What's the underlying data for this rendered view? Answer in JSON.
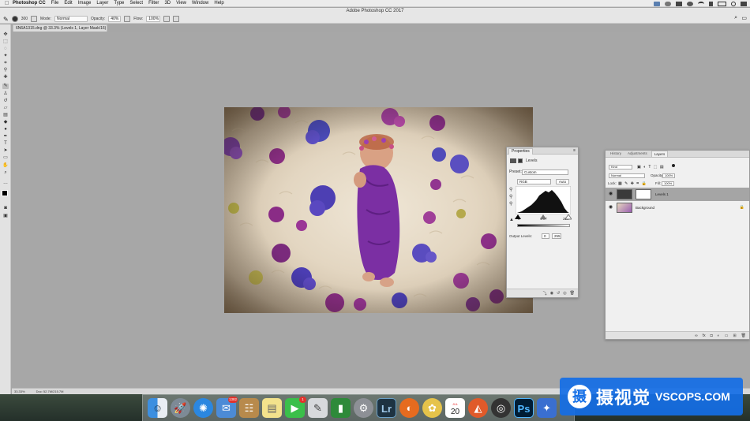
{
  "menubar": {
    "items": [
      "Photoshop CC",
      "File",
      "Edit",
      "Image",
      "Layer",
      "Type",
      "Select",
      "Filter",
      "3D",
      "View",
      "Window",
      "Help"
    ]
  },
  "window": {
    "title": "Adobe Photoshop CC 2017"
  },
  "options": {
    "mode_label": "Mode:",
    "mode_value": "Normal",
    "opacity_label": "Opacity:",
    "opacity_value": "40%",
    "flow_label": "Flow:",
    "flow_value": "100%",
    "brush_size": "300"
  },
  "document": {
    "tab": "6N6A1315.dng @ 33.3% (Levels 1, Layer Mask/16) *"
  },
  "status": {
    "zoom": "33.33%",
    "doc": "Doc: 52.7M/215.7M"
  },
  "properties": {
    "tab": "Properties",
    "adjustment": "Levels",
    "preset_label": "Preset:",
    "preset_value": "Custom",
    "channel_value": "RGB",
    "auto_label": "Auto",
    "input_low": "0",
    "input_mid": "1.07",
    "input_high": "255",
    "output_label": "Output Levels:",
    "output_low": "0",
    "output_high": "255"
  },
  "layers_panel": {
    "tabs": [
      "History",
      "Adjustments",
      "Layers"
    ],
    "kind_value": "Kind",
    "blend_value": "Normal",
    "opacity_label": "Opacity:",
    "opacity_value": "100%",
    "lock_label": "Lock:",
    "fill_label": "Fill:",
    "fill_value": "100%",
    "layers": [
      {
        "name": "Levels 1",
        "selected": true
      },
      {
        "name": "Background",
        "selected": false
      }
    ]
  },
  "dock": {
    "mail_badge": "1382",
    "facetime_badge": "1",
    "calendar_day": "20",
    "calendar_month": "JUL",
    "apps": [
      "finder",
      "launchpad",
      "safari",
      "mail",
      "contacts",
      "notes",
      "facetime",
      "preview",
      "numbers",
      "system-preferences",
      "lightroom",
      "firefox",
      "itunes-pineapple",
      "calendar",
      "affinity",
      "chrome-ext",
      "photoshop",
      "other"
    ]
  },
  "watermark": {
    "cn": "摄视觉",
    "en": "VSCOPS.COM",
    "logo": "摄"
  },
  "colors": {
    "selection": "#a5a5a5",
    "canvas": "#a7a7a7",
    "purple": "#7b2fa3"
  }
}
